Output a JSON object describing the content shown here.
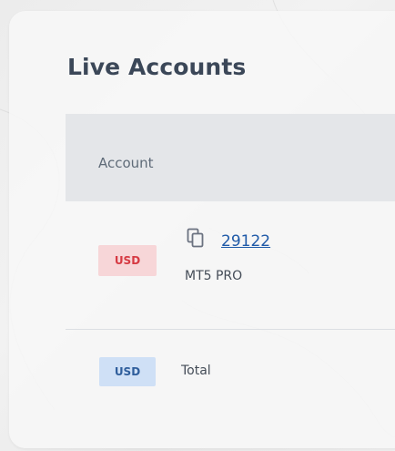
{
  "card": {
    "title": "Live Accounts"
  },
  "table": {
    "columns": [
      "Account"
    ]
  },
  "accounts": [
    {
      "currency": "USD",
      "number": "29122",
      "type": "MT5 PRO"
    }
  ],
  "total": {
    "currency": "USD",
    "label": "Total"
  },
  "icons": {
    "copy": "copy-icon"
  },
  "colors": {
    "badge_red_bg": "#f7d6d8",
    "badge_red_text": "#d63a43",
    "badge_blue_bg": "#cfe0f6",
    "badge_blue_text": "#2f5e9c",
    "link": "#1f5aa8",
    "title": "#3b4758"
  }
}
